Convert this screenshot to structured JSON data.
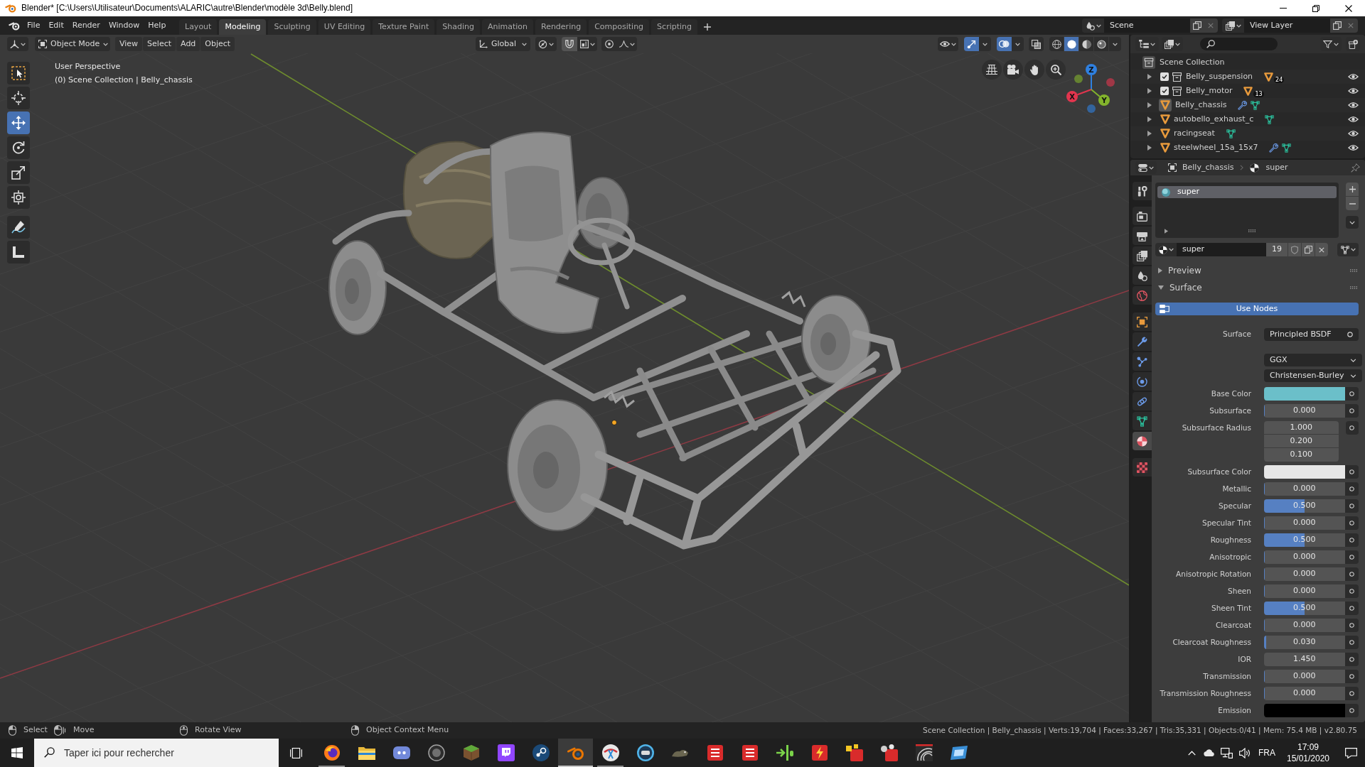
{
  "title_bar": {
    "title": "Blender* [C:\\Users\\Utilisateur\\Documents\\ALARIC\\autre\\Blender\\modèle 3d\\Belly.blend]"
  },
  "top_bar": {
    "menus": [
      "File",
      "Edit",
      "Render",
      "Window",
      "Help"
    ],
    "workspaces": [
      {
        "label": "Layout",
        "selected": false
      },
      {
        "label": "Modeling",
        "selected": true
      },
      {
        "label": "Sculpting",
        "selected": false
      },
      {
        "label": "UV Editing",
        "selected": false
      },
      {
        "label": "Texture Paint",
        "selected": false
      },
      {
        "label": "Shading",
        "selected": false
      },
      {
        "label": "Animation",
        "selected": false
      },
      {
        "label": "Rendering",
        "selected": false
      },
      {
        "label": "Compositing",
        "selected": false
      },
      {
        "label": "Scripting",
        "selected": false
      }
    ],
    "scene": "Scene",
    "view_layer": "View Layer"
  },
  "viewport": {
    "mode": "Object Mode",
    "menus": [
      "View",
      "Select",
      "Add",
      "Object"
    ],
    "orientation": "Global",
    "toggles": [
      {
        "kind": "gizmos",
        "on": true
      },
      {
        "kind": "overlays",
        "on": true
      },
      {
        "kind": "xray",
        "on": false
      }
    ],
    "shading": [
      {
        "kind": "wireframe",
        "selected": false
      },
      {
        "kind": "solid",
        "selected": true
      },
      {
        "kind": "material",
        "selected": false
      },
      {
        "kind": "rendered",
        "selected": false
      }
    ],
    "tools": [
      {
        "kind": "select-box",
        "selected": false
      },
      {
        "kind": "cursor",
        "selected": false
      },
      {
        "kind": "move",
        "selected": true
      },
      {
        "kind": "rotate",
        "selected": false
      },
      {
        "kind": "scale",
        "selected": false
      },
      {
        "kind": "transform",
        "selected": false
      },
      {
        "kind": "annotate",
        "selected": false
      },
      {
        "kind": "measure",
        "selected": false
      }
    ],
    "info": [
      "User Perspective",
      "(0) Scene Collection | Belly_chassis"
    ],
    "gizmo": [
      {
        "label": "Z",
        "color": "#2f80e0"
      },
      {
        "label": "X",
        "color": "#e2354e"
      },
      {
        "label": "Y",
        "color": "#82b32c"
      }
    ]
  },
  "outliner": {
    "root": {
      "label": "Scene Collection",
      "children": [
        {
          "label": "Belly_suspension",
          "kind": "collection",
          "checked": true,
          "count": "24",
          "expanded": false,
          "selected": false,
          "visible": true
        },
        {
          "label": "Belly_motor",
          "kind": "collection",
          "checked": true,
          "count": "13",
          "expanded": false,
          "selected": false,
          "visible": true
        },
        {
          "label": "Belly_chassis",
          "kind": "object",
          "modifier": true,
          "expanded": false,
          "selected": true,
          "visible": true
        },
        {
          "label": "autobello_exhaust_c",
          "kind": "object",
          "modifier": false,
          "expanded": false,
          "selected": false,
          "visible": true
        },
        {
          "label": "racingseat",
          "kind": "object",
          "modifier": false,
          "expanded": false,
          "selected": false,
          "visible": true
        },
        {
          "label": "steelwheel_15a_15x7",
          "kind": "object",
          "modifier": true,
          "expanded": false,
          "selected": false,
          "visible": true
        }
      ]
    }
  },
  "properties": {
    "tabs": [
      {
        "kind": "tool",
        "selected": false
      },
      {
        "kind": "render",
        "selected": false
      },
      {
        "kind": "output",
        "selected": false
      },
      {
        "kind": "view-layer",
        "selected": false
      },
      {
        "kind": "scene",
        "selected": false
      },
      {
        "kind": "world",
        "selected": false
      },
      {
        "kind": "object",
        "selected": false
      },
      {
        "kind": "modifier",
        "selected": false
      },
      {
        "kind": "particles",
        "selected": false
      },
      {
        "kind": "physics",
        "selected": false
      },
      {
        "kind": "constraints",
        "selected": false
      },
      {
        "kind": "data",
        "selected": false
      },
      {
        "kind": "material",
        "selected": true
      },
      {
        "kind": "texture",
        "selected": false
      }
    ],
    "breadcrumb": {
      "object": "Belly_chassis",
      "material": "super"
    },
    "slots": [
      {
        "name": "super",
        "selected": true
      }
    ],
    "material": {
      "name": "super",
      "users": "19"
    },
    "panels": [
      {
        "label": "Preview",
        "expanded": false
      },
      {
        "label": "Surface",
        "expanded": true,
        "use_nodes": "Use Nodes",
        "shader_label": "Surface",
        "shader": "Principled BSDF",
        "distribution": "GGX",
        "subsurface_method": "Christensen-Burley",
        "inputs": [
          {
            "label": "Base Color",
            "kind": "color",
            "color": "#6bbfc9"
          },
          {
            "label": "Subsurface",
            "kind": "slider",
            "value": "0.000",
            "level": 0
          },
          {
            "label": "Subsurface Radius",
            "kind": "vector",
            "values": [
              "1.000",
              "0.200",
              "0.100"
            ]
          },
          {
            "label": "Subsurface Color",
            "kind": "color",
            "color": "#e6e6e6"
          },
          {
            "label": "Metallic",
            "kind": "slider",
            "value": "0.000",
            "level": 0
          },
          {
            "label": "Specular",
            "kind": "slider",
            "value": "0.500",
            "level": 0.5
          },
          {
            "label": "Specular Tint",
            "kind": "slider",
            "value": "0.000",
            "level": 0
          },
          {
            "label": "Roughness",
            "kind": "slider",
            "value": "0.500",
            "level": 0.5
          },
          {
            "label": "Anisotropic",
            "kind": "slider",
            "value": "0.000",
            "level": 0
          },
          {
            "label": "Anisotropic Rotation",
            "kind": "slider",
            "value": "0.000",
            "level": 0
          },
          {
            "label": "Sheen",
            "kind": "slider",
            "value": "0.000",
            "level": 0
          },
          {
            "label": "Sheen Tint",
            "kind": "slider",
            "value": "0.500",
            "level": 0.5
          },
          {
            "label": "Clearcoat",
            "kind": "slider",
            "value": "0.000",
            "level": 0
          },
          {
            "label": "Clearcoat Roughness",
            "kind": "slider",
            "value": "0.030",
            "level": 0.03
          },
          {
            "label": "IOR",
            "kind": "number",
            "value": "1.450"
          },
          {
            "label": "Transmission",
            "kind": "slider",
            "value": "0.000",
            "level": 0
          },
          {
            "label": "Transmission Roughness",
            "kind": "slider",
            "value": "0.000",
            "level": 0
          },
          {
            "label": "Emission",
            "kind": "color",
            "color": "#000000"
          }
        ]
      }
    ]
  },
  "status_bar": {
    "hints": [
      {
        "kind": "left",
        "label": "Select"
      },
      {
        "kind": "drag",
        "label": "Move"
      },
      {
        "kind": "middle",
        "label": "Rotate View"
      },
      {
        "kind": "right",
        "label": "Object Context Menu"
      }
    ],
    "stats": "Scene Collection | Belly_chassis | Verts:19,704 | Faces:33,267 | Tris:35,331 | Objects:0/41 | Mem: 75.4 MB | v2.80.75"
  },
  "taskbar": {
    "search_placeholder": "Taper ici pour rechercher",
    "apps": [
      {
        "kind": "browser",
        "active": false,
        "running": true
      },
      {
        "kind": "folder",
        "active": false,
        "running": false
      },
      {
        "kind": "chat",
        "active": false,
        "running": false
      },
      {
        "kind": "badge",
        "active": false,
        "running": false
      },
      {
        "kind": "block",
        "active": false,
        "running": false
      },
      {
        "kind": "stream",
        "active": false,
        "running": false
      },
      {
        "kind": "steam",
        "active": false,
        "running": false
      },
      {
        "kind": "blender",
        "active": true,
        "running": true
      },
      {
        "kind": "snip",
        "active": false,
        "running": true
      },
      {
        "kind": "remote",
        "active": false,
        "running": false
      },
      {
        "kind": "creature",
        "active": false,
        "running": false
      },
      {
        "kind": "cad",
        "active": false,
        "running": false
      },
      {
        "kind": "cad",
        "active": false,
        "running": false
      },
      {
        "kind": "viewer",
        "active": false,
        "running": false
      },
      {
        "kind": "cad-bolt",
        "active": false,
        "running": false
      },
      {
        "kind": "cad-cubes",
        "active": false,
        "running": false
      },
      {
        "kind": "cad-spheres",
        "active": false,
        "running": false
      },
      {
        "kind": "arc",
        "active": false,
        "running": false
      },
      {
        "kind": "window",
        "active": false,
        "running": false
      }
    ],
    "language": "FRA",
    "time": "17:09",
    "date": "15/01/2020"
  }
}
